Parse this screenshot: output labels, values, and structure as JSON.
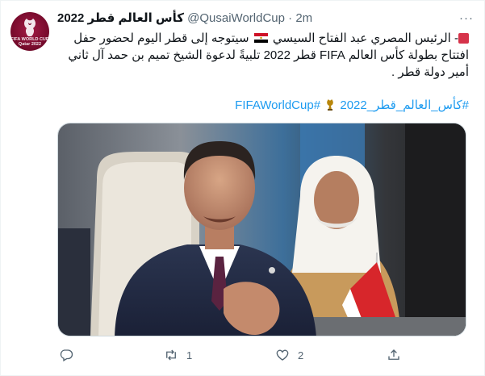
{
  "tweet": {
    "display_name": "كأس العالم قطر 2022",
    "handle": "@QusaiWorldCup",
    "separator": "·",
    "time": "2m",
    "more_label": "···",
    "avatar": {
      "icon": "world-cup-emblem-icon",
      "text": "FIFA WORLD CUP Qatar 2022",
      "color": "#7a0c2e"
    },
    "text_lines": [
      "- الرئيس المصري عبد الفتاح السيسي",
      "سيتوجه إلى قطر اليوم لحضور حفل",
      "افتتاح بطولة كأس العالم FIFA قطر 2022 تلبيةً لدعوة الشيخ تميم بن حمد آل ثاني",
      "أمير دولة قطر ."
    ],
    "hashtags": [
      "#كأس_العالم_قطر_2022",
      "#FIFAWorldCup"
    ],
    "link_color": "#1d9bf0"
  },
  "actions": {
    "reply": {
      "icon": "reply-icon",
      "count": ""
    },
    "retweet": {
      "icon": "retweet-icon",
      "count": "1"
    },
    "like": {
      "icon": "heart-icon",
      "count": "2"
    },
    "share": {
      "icon": "share-icon",
      "count": ""
    }
  }
}
